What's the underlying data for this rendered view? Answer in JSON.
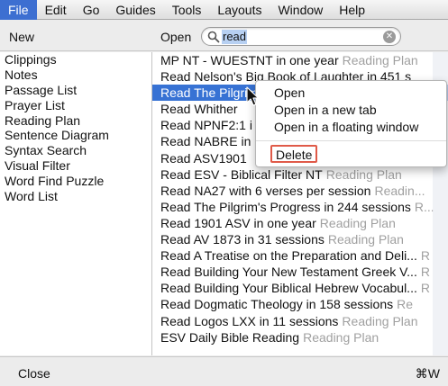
{
  "menubar": {
    "items": [
      "File",
      "Edit",
      "Go",
      "Guides",
      "Tools",
      "Layouts",
      "Window",
      "Help"
    ]
  },
  "header": {
    "new_label": "New",
    "open_label": "Open",
    "search_value": "read"
  },
  "left_list": {
    "items": [
      "Clippings",
      "Notes",
      "Passage List",
      "Prayer List",
      "Reading Plan",
      "Sentence Diagram",
      "Syntax Search",
      "Visual Filter",
      "Word Find Puzzle",
      "Word List"
    ]
  },
  "right_list": {
    "rows": [
      {
        "title": "MP NT - WUESTNT in one year",
        "type": "Reading Plan"
      },
      {
        "title": "Read Nelson's Big Book of Laughter in 451 s",
        "type": ""
      },
      {
        "title": "Read The Pilgrim",
        "type": ""
      },
      {
        "title": "Read Whither",
        "type": ""
      },
      {
        "title": "Read NPNF2:1 i",
        "type": ""
      },
      {
        "title": "Read NABRE in",
        "type": ""
      },
      {
        "title": "Read ASV1901",
        "type": ""
      },
      {
        "title": "Read ESV - Biblical Filter NT",
        "type": "Reading Plan"
      },
      {
        "title": "Read NA27 with 6 verses per session",
        "type": "Readin..."
      },
      {
        "title": "Read The Pilgrim's Progress in 244 sessions",
        "type": "R..."
      },
      {
        "title": "Read 1901 ASV in one year",
        "type": "Reading Plan"
      },
      {
        "title": "Read AV 1873 in 31 sessions",
        "type": "Reading Plan"
      },
      {
        "title": "Read A Treatise on the Preparation and Deli...",
        "type": "R"
      },
      {
        "title": "Read Building Your New Testament Greek V...",
        "type": "R"
      },
      {
        "title": "Read Building Your Biblical Hebrew Vocabul...",
        "type": "R"
      },
      {
        "title": "Read Dogmatic Theology in 158 sessions",
        "type": "Re"
      },
      {
        "title": "Read Logos LXX in 11 sessions",
        "type": "Reading Plan"
      },
      {
        "title": "ESV Daily Bible Reading",
        "type": "Reading Plan"
      }
    ],
    "selected_index": 2
  },
  "context_menu": {
    "items": [
      "Open",
      "Open in a new tab",
      "Open in a floating window"
    ],
    "delete_label": "Delete"
  },
  "footer": {
    "close_label": "Close",
    "shortcut_label": "⌘W"
  },
  "colors": {
    "selection": "#3772d4",
    "menu_active": "#3d6fd1",
    "delete_outline": "#e05a48"
  }
}
